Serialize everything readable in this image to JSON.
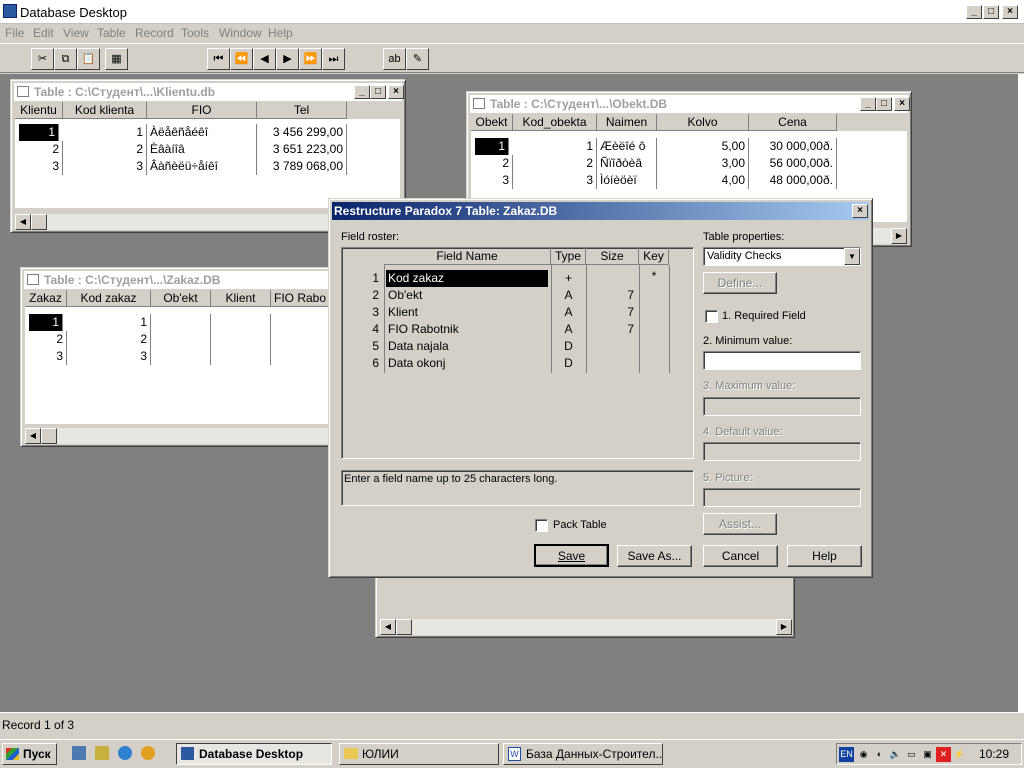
{
  "app": {
    "title": "Database Desktop",
    "menu": [
      "File",
      "Edit",
      "View",
      "Table",
      "Record",
      "Tools",
      "Window",
      "Help"
    ],
    "status": "Record 1 of 3"
  },
  "toolbar": {
    "buttons": [
      {
        "name": "cut-icon",
        "glyph": "✂"
      },
      {
        "name": "copy-icon",
        "glyph": "⧉"
      },
      {
        "name": "paste-icon",
        "glyph": "📋"
      },
      {
        "name": "print-icon",
        "glyph": "▦"
      },
      {
        "name": "first-record-icon",
        "glyph": "⏮"
      },
      {
        "name": "prev-set-icon",
        "glyph": "⏪"
      },
      {
        "name": "prev-record-icon",
        "glyph": "◀"
      },
      {
        "name": "next-record-icon",
        "glyph": "▶"
      },
      {
        "name": "next-set-icon",
        "glyph": "⏩"
      },
      {
        "name": "last-record-icon",
        "glyph": "⏭"
      },
      {
        "name": "edit-field-icon",
        "glyph": "ab"
      },
      {
        "name": "edit-data-icon",
        "glyph": "✎"
      }
    ]
  },
  "klientu": {
    "title": "Table : C:\\Студент\\...\\Klientu.db",
    "headers": [
      "Klientu",
      "Kod klienta",
      "FIO",
      "Tel"
    ],
    "rows": [
      [
        "1",
        "1",
        "Àëåêñåéêî",
        "3 456 299,00"
      ],
      [
        "2",
        "2",
        "Èâàíîâ",
        "3 651 223,00"
      ],
      [
        "3",
        "3",
        "Âàñèëü÷åíêî",
        "3 789 068,00"
      ]
    ]
  },
  "obekt": {
    "title": "Table : C:\\Студент\\...\\Obekt.DB",
    "headers": [
      "Obekt",
      "Kod_obekta",
      "Naimen",
      "Kolvo",
      "Cena"
    ],
    "rows": [
      [
        "1",
        "1",
        "Æèëîé ô",
        "5,00",
        "30 000,00ð."
      ],
      [
        "2",
        "2",
        "Ñïîðòèâ",
        "3,00",
        "56 000,00ð."
      ],
      [
        "3",
        "3",
        "Ìóíèöèï",
        "4,00",
        "48 000,00ð."
      ]
    ]
  },
  "zakaz": {
    "title": "Table : C:\\Студент\\...\\Zakaz.DB",
    "headers": [
      "Zakaz",
      "Kod zakaz",
      "Ob'ekt",
      "Klient",
      "FIO Rabo"
    ],
    "rows": [
      [
        "1",
        "1"
      ],
      [
        "2",
        "2"
      ],
      [
        "3",
        "3"
      ]
    ]
  },
  "dialog": {
    "title": "Restructure Paradox 7 Table: Zakaz.DB",
    "field_roster_label": "Field roster:",
    "roster_headers": [
      "Field Name",
      "Type",
      "Size",
      "Key"
    ],
    "fields": [
      {
        "num": "1",
        "name": "Kod zakaz",
        "type": "+",
        "size": "",
        "key": "*"
      },
      {
        "num": "2",
        "name": "Ob'ekt",
        "type": "A",
        "size": "7",
        "key": ""
      },
      {
        "num": "3",
        "name": "Klient",
        "type": "A",
        "size": "7",
        "key": ""
      },
      {
        "num": "4",
        "name": "FIO Rabotnik",
        "type": "A",
        "size": "7",
        "key": ""
      },
      {
        "num": "5",
        "name": "Data najala",
        "type": "D",
        "size": "",
        "key": ""
      },
      {
        "num": "6",
        "name": "Data okonj",
        "type": "D",
        "size": "",
        "key": ""
      }
    ],
    "hint": "Enter a field name up to 25 characters long.",
    "pack_table": "Pack Table",
    "table_properties_label": "Table properties:",
    "table_properties_value": "Validity Checks",
    "define": "Define...",
    "required_field": "1. Required Field",
    "minimum_value": "2. Minimum value:",
    "maximum_value": "3. Maximum value:",
    "default_value": "4. Default value:",
    "picture": "5. Picture:",
    "assist": "Assist...",
    "save": "Save",
    "save_as": "Save As...",
    "cancel": "Cancel",
    "help": "Help"
  },
  "taskbar": {
    "start": "Пуск",
    "tasks": [
      "Database Desktop",
      "ЮЛИИ",
      "База Данных-Строител..."
    ],
    "lang": "EN",
    "clock": "10:29"
  }
}
